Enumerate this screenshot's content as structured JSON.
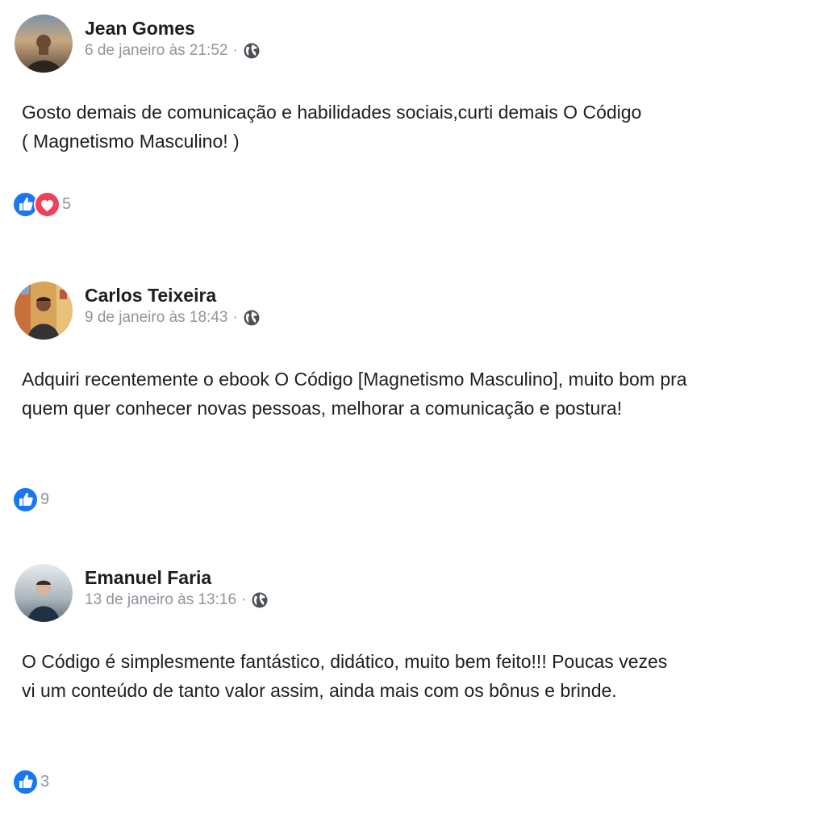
{
  "posts": [
    {
      "author": "Jean Gomes",
      "date": "6 de janeiro às 21:52",
      "separator": "·",
      "privacy_icon": "globe-icon",
      "text": "Gosto demais de comunicação e habilidades sociais,curti demais O Código ( Magnetismo Masculino! )",
      "reactions": [
        "like-icon",
        "love-icon"
      ],
      "reaction_count": "5"
    },
    {
      "author": "Carlos Teixeira",
      "date": "9 de janeiro às 18:43",
      "separator": "·",
      "privacy_icon": "globe-icon",
      "text": "Adquiri recentemente o ebook O Código [Magnetismo Masculino], muito bom pra quem quer conhecer novas pessoas, melhorar a comunicação e postura!",
      "reactions": [
        "like-icon"
      ],
      "reaction_count": "9"
    },
    {
      "author": "Emanuel Faria",
      "date": "13 de janeiro às 13:16",
      "separator": "·",
      "privacy_icon": "globe-icon",
      "text": "O Código é simplesmente fantástico, didático, muito bem feito!!! Poucas vezes vi um conteúdo de tanto valor assim, ainda mais com os bônus e brinde.",
      "reactions": [
        "like-icon"
      ],
      "reaction_count": "3"
    }
  ],
  "colors": {
    "like": "#1877f2",
    "love": "#f33e58",
    "meta_text": "#90949c",
    "body_text": "#1c1e21"
  }
}
